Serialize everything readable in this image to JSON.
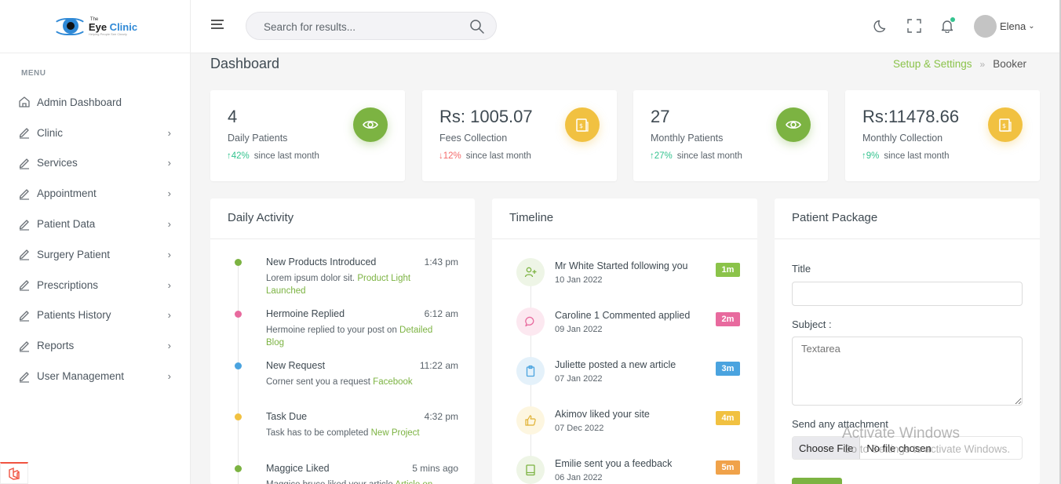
{
  "brand": {
    "the": "The",
    "name_part1": "Eye",
    "name_part2": " Clinic",
    "tagline": "Helping People See Clearly"
  },
  "sidebar": {
    "menu_title": "MENU",
    "items": [
      {
        "label": "Admin Dashboard",
        "icon": "dashboard-icon",
        "has_chevron": false
      },
      {
        "label": "Clinic",
        "icon": "edit-icon",
        "has_chevron": true
      },
      {
        "label": "Services",
        "icon": "edit-icon",
        "has_chevron": true
      },
      {
        "label": "Appointment",
        "icon": "edit-icon",
        "has_chevron": true
      },
      {
        "label": "Patient Data",
        "icon": "edit-icon",
        "has_chevron": true
      },
      {
        "label": "Surgery Patient",
        "icon": "edit-icon",
        "has_chevron": true
      },
      {
        "label": "Prescriptions",
        "icon": "edit-icon",
        "has_chevron": true
      },
      {
        "label": "Patients History",
        "icon": "edit-icon",
        "has_chevron": true
      },
      {
        "label": "Reports",
        "icon": "edit-icon",
        "has_chevron": true
      },
      {
        "label": "User Management",
        "icon": "edit-icon",
        "has_chevron": true
      }
    ],
    "chevron": "›"
  },
  "topbar": {
    "search_placeholder": "Search for results...",
    "user_name": "Elena",
    "user_chevron": "⌄",
    "notification_dot_color": "#34c38f"
  },
  "page": {
    "title": "Dashboard",
    "breadcrumb": [
      "Setup & Settings",
      "Booker"
    ],
    "breadcrumb_sep": "»"
  },
  "stats": [
    {
      "value": "4",
      "label": "Daily Patients",
      "change": "42%",
      "direction": "up",
      "arrow": "↑",
      "suffix": "since last month",
      "icon": "eye-icon",
      "color": "green"
    },
    {
      "value": "Rs: 1005.07",
      "label": "Fees Collection",
      "change": "12%",
      "direction": "down",
      "arrow": "↓",
      "suffix": "since last month",
      "icon": "money-icon",
      "color": "yellow"
    },
    {
      "value": "27",
      "label": "Monthly Patients",
      "change": "27%",
      "direction": "up",
      "arrow": "↑",
      "suffix": "since last month",
      "icon": "eye-icon",
      "color": "green"
    },
    {
      "value": "Rs:11478.66",
      "label": "Monthly Collection",
      "change": "9%",
      "direction": "up",
      "arrow": "↑",
      "suffix": "since last month",
      "icon": "money-icon",
      "color": "yellow"
    }
  ],
  "daily_activity": {
    "title": "Daily Activity",
    "items": [
      {
        "title": "New Products Introduced",
        "time": "1:43 pm",
        "desc": "Lorem ipsum dolor sit.",
        "highlight": "Product Light Launched",
        "dot": "#7cb342"
      },
      {
        "title": "Hermoine Replied",
        "time": "6:12 am",
        "desc": "Hermoine replied to your post on",
        "highlight": "Detailed Blog",
        "dot": "#e86a9e"
      },
      {
        "title": "New Request",
        "time": "11:22 am",
        "desc": "Corner sent you a request",
        "highlight": "Facebook",
        "dot": "#4aa3df"
      },
      {
        "title": "Task Due",
        "time": "4:32 pm",
        "desc": "Task has to be completed",
        "highlight": "New Project",
        "dot": "#f1c141"
      },
      {
        "title": "Maggice Liked",
        "time": "5 mins ago",
        "desc": "Maggice bruce liked your article",
        "highlight": "Article on",
        "dot": "#7cb342"
      }
    ]
  },
  "timeline": {
    "title": "Timeline",
    "items": [
      {
        "text": "Mr White Started following you",
        "date": "10 Jan 2022",
        "badge": "1m",
        "badge_color": "#8bc34a",
        "icon": "user-plus-icon",
        "icon_bg": "#eef5e6",
        "icon_color": "#7cb342"
      },
      {
        "text": "Caroline 1 Commented applied",
        "date": "09 Jan 2022",
        "badge": "2m",
        "badge_color": "#e86a9e",
        "icon": "comment-icon",
        "icon_bg": "#fce8f0",
        "icon_color": "#e86a9e"
      },
      {
        "text": "Juliette posted a new article",
        "date": "07 Jan 2022",
        "badge": "3m",
        "badge_color": "#4aa3df",
        "icon": "clipboard-icon",
        "icon_bg": "#e4f1fa",
        "icon_color": "#4aa3df"
      },
      {
        "text": "Akimov liked your site",
        "date": "07 Dec 2022",
        "badge": "4m",
        "badge_color": "#f1c141",
        "icon": "thumbs-up-icon",
        "icon_bg": "#fdf6e0",
        "icon_color": "#e0b030"
      },
      {
        "text": "Emilie sent you a feedback",
        "date": "06 Jan 2022",
        "badge": "5m",
        "badge_color": "#f0a24a",
        "icon": "book-icon",
        "icon_bg": "#eef5e6",
        "icon_color": "#7cb342"
      }
    ]
  },
  "patient_package": {
    "title": "Patient Package",
    "title_label": "Title",
    "title_value": "",
    "subject_label": "Subject :",
    "subject_placeholder": "Textarea",
    "attachment_label": "Send any attachment",
    "file_button": "Choose File",
    "file_status": "No file chosen"
  },
  "watermark": {
    "line1": "Activate Windows",
    "line2": "Go to Settings to activate Windows."
  },
  "colors": {
    "accent_green": "#7cb342",
    "accent_yellow": "#f1c141",
    "up": "#34c38f",
    "down": "#f46a6a"
  }
}
